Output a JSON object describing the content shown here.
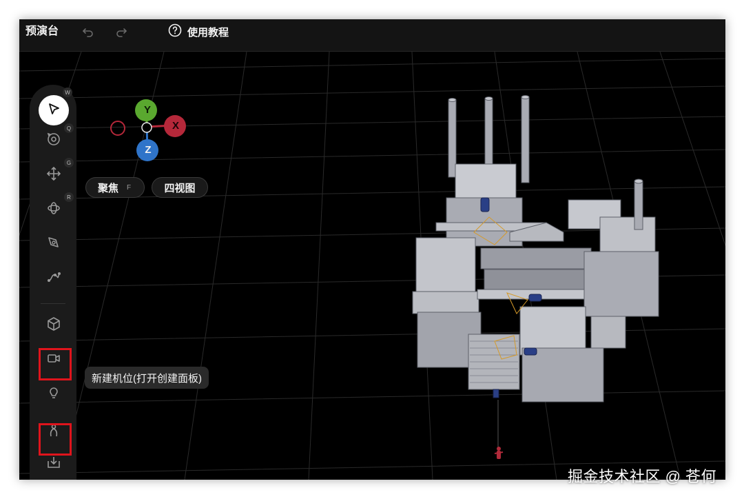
{
  "topbar": {
    "title": "预演台",
    "help_label": "使用教程"
  },
  "gizmo": {
    "y_label": "Y",
    "x_label": "X",
    "z_label": "Z"
  },
  "buttons": {
    "focus_label": "聚焦",
    "focus_key": "F",
    "four_view_label": "四视图"
  },
  "tools": [
    {
      "name": "select",
      "key": "W"
    },
    {
      "name": "orbit",
      "key": "Q"
    },
    {
      "name": "move",
      "key": "G"
    },
    {
      "name": "rotate",
      "key": "R"
    },
    {
      "name": "pen"
    },
    {
      "name": "path"
    },
    {
      "name": "object"
    },
    {
      "name": "camera"
    },
    {
      "name": "light"
    },
    {
      "name": "actor"
    },
    {
      "name": "import"
    }
  ],
  "tooltip": "新建机位(打开创建面板)",
  "watermark": "掘金技术社区 @ 苍何",
  "colors": {
    "axis_y": "#5aa82f",
    "axis_x": "#b5283a",
    "axis_z": "#2f74c9",
    "highlight": "#e0141c"
  }
}
